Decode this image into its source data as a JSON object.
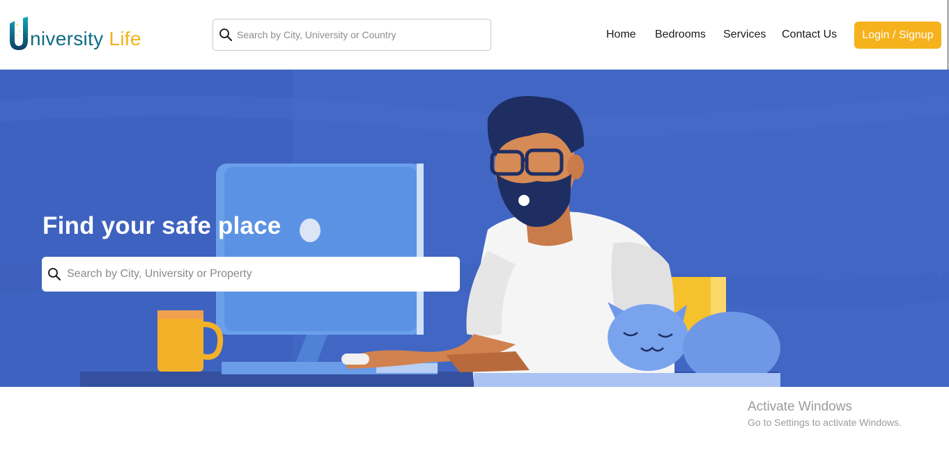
{
  "brand": {
    "name_part1": "niversity",
    "name_part2": "Life",
    "primary_color": "#0f6b85",
    "accent_color": "#f2b21a"
  },
  "header": {
    "search_placeholder": "Search by City, University or Country",
    "search_icon": "search-icon",
    "nav": [
      {
        "label": "Home"
      },
      {
        "label": "Bedrooms"
      },
      {
        "label": "Services"
      },
      {
        "label": "Contact Us"
      }
    ],
    "login_label": "Login / Signup",
    "login_color": "#f6b21c"
  },
  "hero": {
    "title": "Find your safe place",
    "search_placeholder": "Search by City, University or Property",
    "background_color": "#4166c4"
  },
  "watermark": {
    "title": "Activate Windows",
    "subtitle": "Go to Settings to activate Windows."
  }
}
